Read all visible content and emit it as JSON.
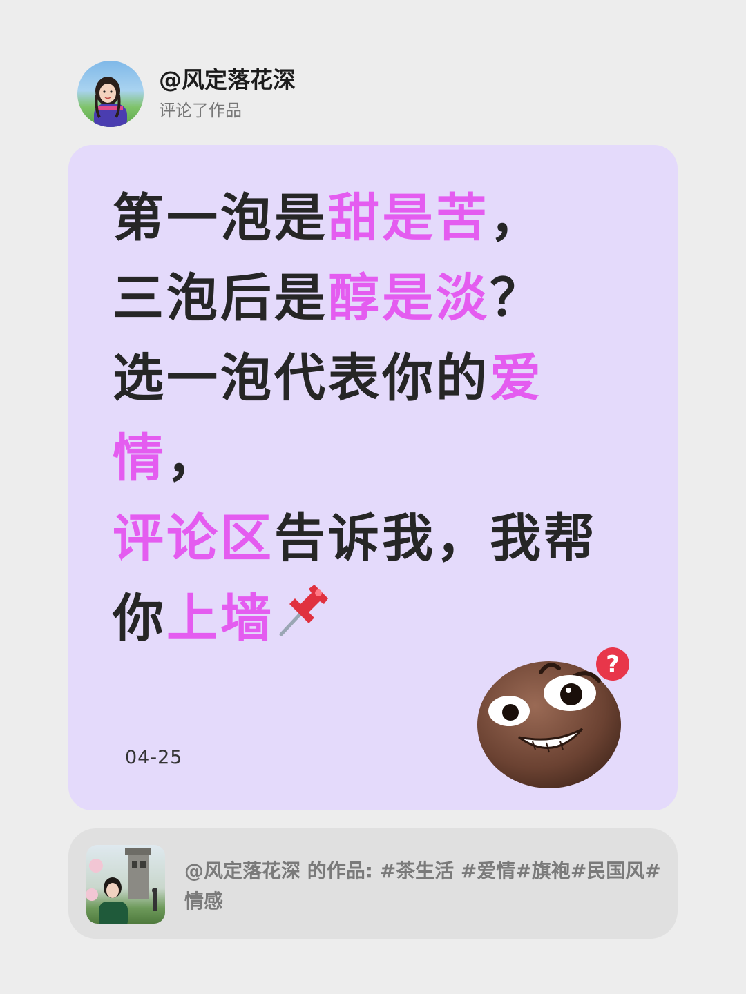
{
  "header": {
    "username": "@风定落花深",
    "action": "评论了作品",
    "avatar_icon": "user-avatar-photo"
  },
  "post": {
    "lines": [
      {
        "parts": [
          {
            "text": "第一泡是",
            "hl": false
          },
          {
            "text": "甜是苦",
            "hl": true
          },
          {
            "text": "，",
            "hl": false
          }
        ]
      },
      {
        "parts": [
          {
            "text": "三泡后是",
            "hl": false
          },
          {
            "text": "醇是淡",
            "hl": true
          },
          {
            "text": "？",
            "hl": false
          }
        ]
      },
      {
        "parts": [
          {
            "text": "选一泡代表你的",
            "hl": false
          },
          {
            "text": "爱",
            "hl": true
          }
        ]
      },
      {
        "parts": [
          {
            "text": "情",
            "hl": true
          },
          {
            "text": "，",
            "hl": false
          }
        ]
      },
      {
        "parts": [
          {
            "text": "评论区",
            "hl": true
          },
          {
            "text": "告诉我，我帮",
            "hl": false
          }
        ]
      },
      {
        "parts": [
          {
            "text": "你",
            "hl": false
          },
          {
            "text": "上墙",
            "hl": true
          }
        ]
      }
    ],
    "trailing_icon": "pushpin-icon",
    "date": "04-25",
    "sticker_icon": "confused-face-emoji",
    "colors": {
      "highlight": "#e45cf0",
      "text": "#262626",
      "card_bg": "#e4dafb"
    }
  },
  "reference": {
    "text": "@风定落花深  的作品: #茶生活 #爱情#旗袍#民国风#情感",
    "thumb_icon": "work-thumbnail-photo"
  }
}
